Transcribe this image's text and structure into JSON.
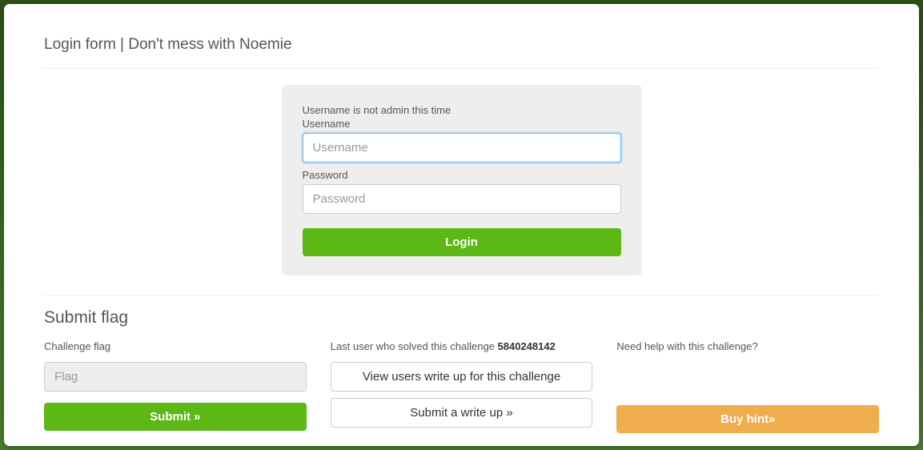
{
  "header": {
    "title": "Login form | Don't mess with Noemie"
  },
  "login": {
    "hint": "Username is not admin this time",
    "username_label": "Username",
    "username_placeholder": "Username",
    "username_value": "",
    "password_label": "Password",
    "password_placeholder": "Password",
    "password_value": "",
    "button_label": "Login"
  },
  "submit_section": {
    "title": "Submit flag",
    "flag_label": "Challenge flag",
    "flag_placeholder": "Flag",
    "flag_value": "",
    "submit_label": "Submit »"
  },
  "writeup_section": {
    "last_solver_prefix": "Last user who solved this challenge ",
    "last_solver_id": "5840248142",
    "view_writeup_label": "View users write up for this challenge",
    "submit_writeup_label": "Submit a write up »"
  },
  "hint_section": {
    "help_text": "Need help with this challenge?",
    "buy_hint_label": "Buy hint»"
  }
}
